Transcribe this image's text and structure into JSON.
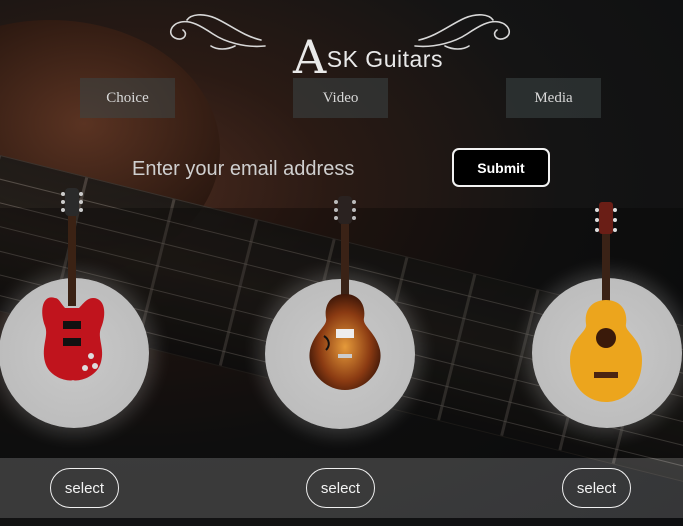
{
  "brand": {
    "logo_letter": "A",
    "logo_rest": "SK Guitars"
  },
  "nav": [
    {
      "label": "Choice"
    },
    {
      "label": "Video"
    },
    {
      "label": "Media"
    }
  ],
  "signup": {
    "placeholder": "Enter your email address",
    "submit_label": "Submit"
  },
  "products": [
    {
      "name": "electric-guitar",
      "select_label": "select",
      "color": "#b3141c"
    },
    {
      "name": "hollow-body-guitar",
      "select_label": "select",
      "color": "#8a3a12"
    },
    {
      "name": "classical-guitar",
      "select_label": "select",
      "color": "#e8a21a"
    }
  ]
}
